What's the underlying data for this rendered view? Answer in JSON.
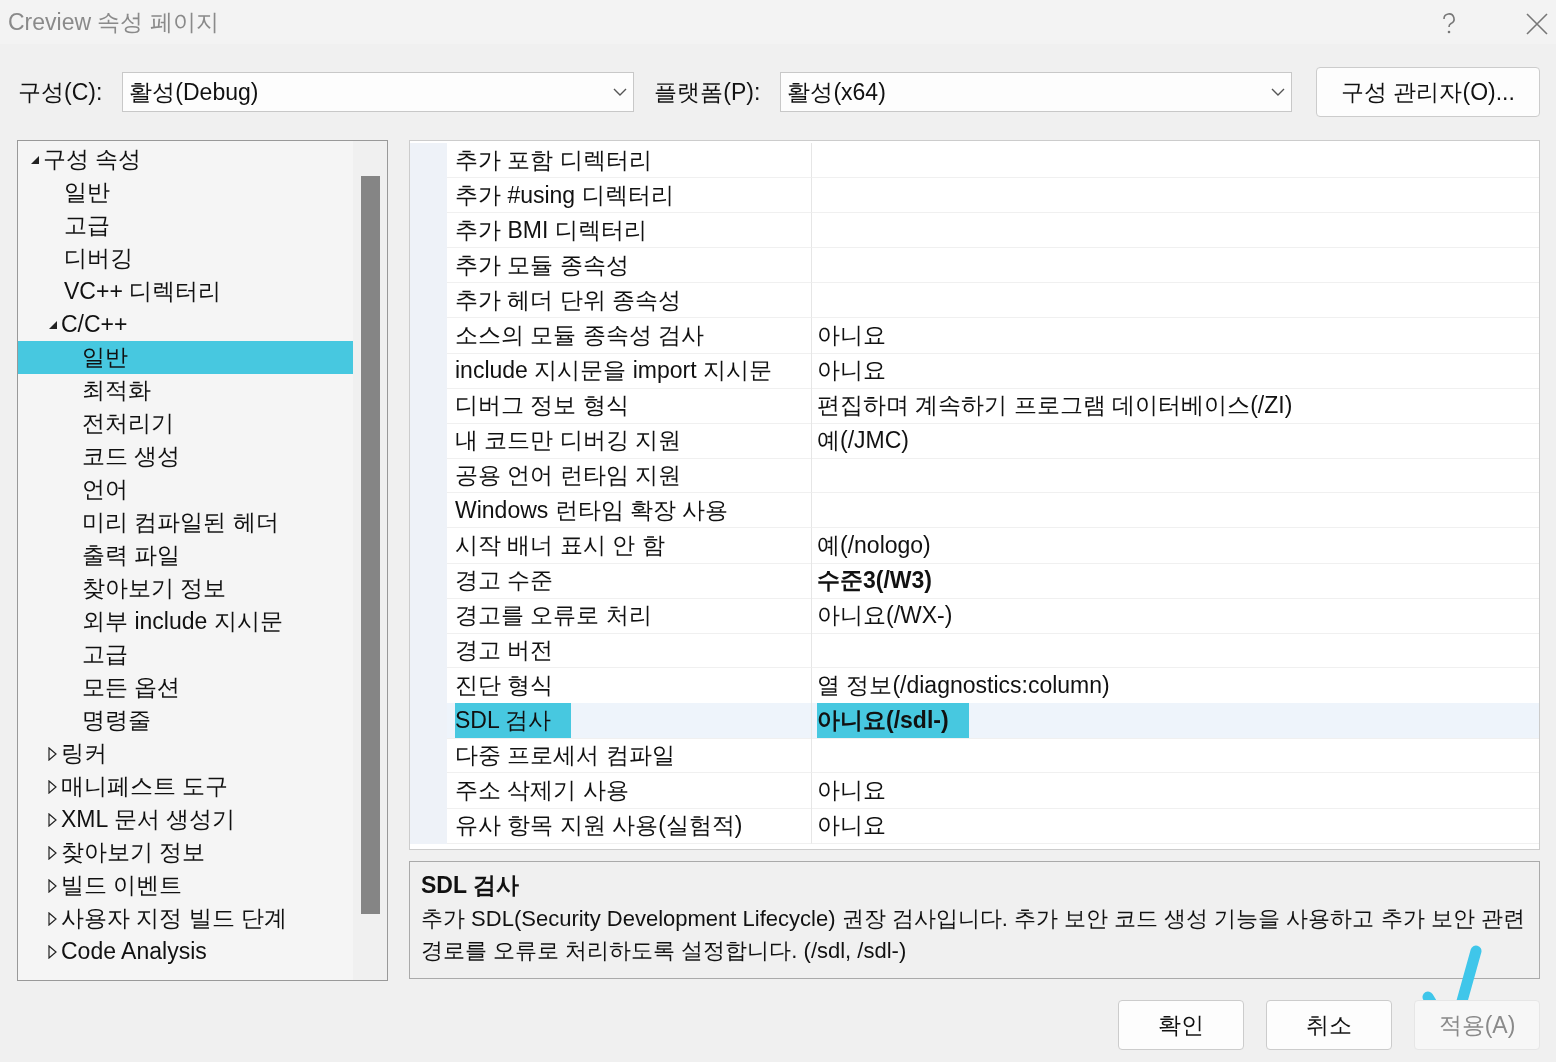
{
  "window": {
    "title": "Creview 속성 페이지"
  },
  "config": {
    "label": "구성(C):",
    "value": "활성(Debug)"
  },
  "platform": {
    "label": "플랫폼(P):",
    "value": "활성(x64)"
  },
  "config_manager_button": "구성 관리자(O)...",
  "tree": [
    {
      "label": "구성 속성",
      "expanded": true,
      "selected": false,
      "children": [
        {
          "label": "일반",
          "selected": false
        },
        {
          "label": "고급",
          "selected": false
        },
        {
          "label": "디버깅",
          "selected": false
        },
        {
          "label": "VC++ 디렉터리",
          "selected": false
        },
        {
          "label": "C/C++",
          "expanded": true,
          "selected": false,
          "children": [
            {
              "label": "일반",
              "selected": true
            },
            {
              "label": "최적화",
              "selected": false
            },
            {
              "label": "전처리기",
              "selected": false
            },
            {
              "label": "코드 생성",
              "selected": false
            },
            {
              "label": "언어",
              "selected": false
            },
            {
              "label": "미리 컴파일된 헤더",
              "selected": false
            },
            {
              "label": "출력 파일",
              "selected": false
            },
            {
              "label": "찾아보기 정보",
              "selected": false
            },
            {
              "label": "외부 include 지시문",
              "selected": false
            },
            {
              "label": "고급",
              "selected": false
            },
            {
              "label": "모든 옵션",
              "selected": false
            },
            {
              "label": "명령줄",
              "selected": false
            }
          ]
        },
        {
          "label": "링커",
          "expanded": false,
          "selected": false
        },
        {
          "label": "매니페스트 도구",
          "expanded": false,
          "selected": false
        },
        {
          "label": "XML 문서 생성기",
          "expanded": false,
          "selected": false
        },
        {
          "label": "찾아보기 정보",
          "expanded": false,
          "selected": false
        },
        {
          "label": "빌드 이벤트",
          "expanded": false,
          "selected": false
        },
        {
          "label": "사용자 지정 빌드 단계",
          "expanded": false,
          "selected": false
        },
        {
          "label": "Code Analysis",
          "expanded": false,
          "selected": false
        }
      ]
    }
  ],
  "properties": [
    {
      "name": "추가 포함 디렉터리",
      "selected": false
    },
    {
      "name": "추가 #using 디렉터리",
      "selected": false
    },
    {
      "name": "추가 BMI 디렉터리",
      "selected": false
    },
    {
      "name": "추가 모듈 종속성",
      "selected": false
    },
    {
      "name": "추가 헤더 단위 종속성",
      "selected": false
    },
    {
      "name": "소스의 모듈 종속성 검사",
      "value": "아니요",
      "modified": false,
      "selected": false
    },
    {
      "name": "include 지시문을 import 지시문",
      "value": "아니요",
      "modified": false,
      "selected": false
    },
    {
      "name": "디버그 정보 형식",
      "value": "편집하며 계속하기 프로그램 데이터베이스(/ZI)",
      "modified": false,
      "selected": false
    },
    {
      "name": "내 코드만 디버깅 지원",
      "value": "예(/JMC)",
      "modified": false,
      "selected": false
    },
    {
      "name": "공용 언어 런타임 지원",
      "selected": false
    },
    {
      "name": "Windows 런타임 확장 사용",
      "selected": false
    },
    {
      "name": "시작 배너 표시 안 함",
      "value": "예(/nologo)",
      "modified": false,
      "selected": false
    },
    {
      "name": "경고 수준",
      "value": "수준3(/W3)",
      "modified": true,
      "selected": false
    },
    {
      "name": "경고를 오류로 처리",
      "value": "아니요(/WX-)",
      "modified": false,
      "selected": false
    },
    {
      "name": "경고 버전",
      "selected": false
    },
    {
      "name": "진단 형식",
      "value": "열 정보(/diagnostics:column)",
      "modified": false,
      "selected": false
    },
    {
      "name": "SDL 검사",
      "value": "아니요(/sdl-)",
      "modified": true,
      "selected": true
    },
    {
      "name": "다중 프로세서 컴파일",
      "selected": false
    },
    {
      "name": "주소 삭제기 사용",
      "value": "아니요",
      "modified": false,
      "selected": false
    },
    {
      "name": "유사 항목 지원 사용(실험적)",
      "value": "아니요",
      "modified": false,
      "selected": false
    }
  ],
  "description": {
    "title": "SDL 검사",
    "text": "추가 SDL(Security Development Lifecycle) 권장 검사입니다. 추가 보안 코드 생성 기능을 사용하고 추가 보안 관련 경로를 오류로 처리하도록 설정합니다. (/sdl, /sdl-)"
  },
  "buttons": [
    {
      "label": "확인",
      "disabled": false,
      "marked": false
    },
    {
      "label": "취소",
      "disabled": false,
      "marked": false
    },
    {
      "label": "적용(A)",
      "disabled": true,
      "marked": true
    }
  ]
}
